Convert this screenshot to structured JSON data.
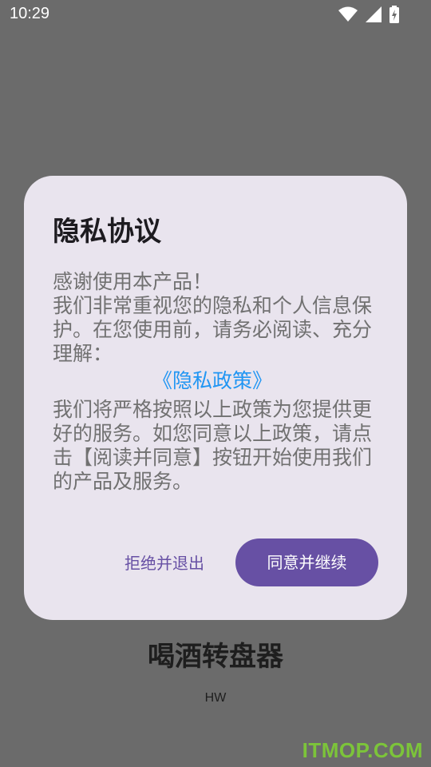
{
  "status_bar": {
    "time": "10:29",
    "icons": [
      "wifi-icon",
      "signal-icon",
      "battery-icon"
    ]
  },
  "dialog": {
    "title": "隐私协议",
    "greeting": "感谢使用本产品！",
    "intro": "我们非常重视您的隐私和个人信息保护。在您使用前，请务必阅读、充分理解：",
    "policy_link": "《隐私政策》",
    "closing": "我们将严格按照以上政策为您提供更好的服务。如您同意以上政策，请点击【阅读并同意】按钮开始使用我们的产品及服务。",
    "decline_label": "拒绝并退出",
    "accept_label": "同意并继续"
  },
  "background": {
    "app_title": "喝酒转盘器",
    "app_subtitle": "HW"
  },
  "watermark": "ITMOP.COM",
  "colors": {
    "scrim": "#6b6b6b",
    "dialog_bg": "#e9e4ee",
    "accent": "#6750a4",
    "link": "#2196f3",
    "body_text": "#717171",
    "watermark": "#7cc43a"
  }
}
